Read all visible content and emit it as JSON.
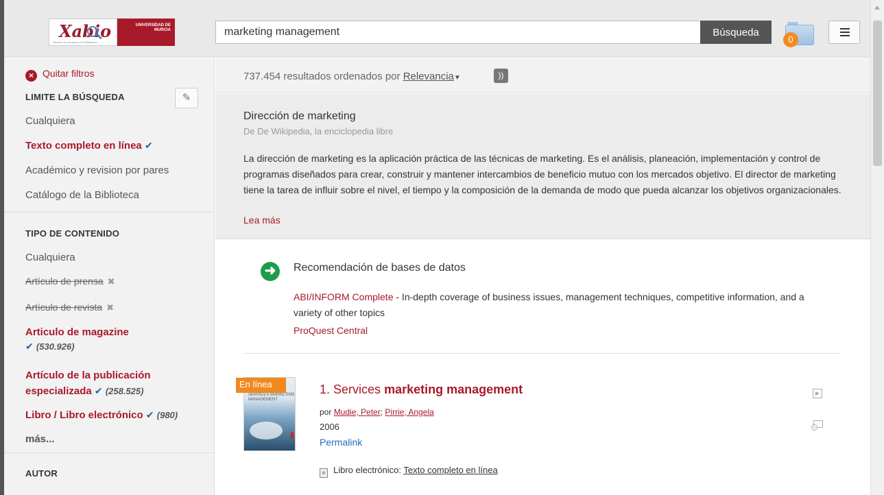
{
  "header": {
    "logo_name": "Xabio",
    "logo_sub": "Servicio de recursos de la Biblioteca",
    "university": "UNIVERSIDAD DE",
    "university_city": "MURCIA",
    "search_value": "marketing management",
    "search_button": "Búsqueda",
    "folder_count": "0",
    "brand_color": "#a8192a"
  },
  "sidebar": {
    "clear_filters": "Quitar filtros",
    "limit_heading": "LIMITE LA BÚSQUEDA",
    "limit_items": [
      {
        "label": "Cualquiera"
      },
      {
        "label": "Texto completo en línea"
      },
      {
        "label": "Académico y revision por pares"
      },
      {
        "label": "Catálogo de la Biblioteca"
      }
    ],
    "content_heading": "TIPO DE CONTENIDO",
    "content_items": [
      {
        "label": "Cualquiera"
      },
      {
        "label": "Artículo de prensa"
      },
      {
        "label": "Artículo de revista"
      },
      {
        "label": "Articulo de magazine",
        "count": "(530.926)"
      },
      {
        "label_line1": "Artículo de la publicación",
        "label_line2": "especializada",
        "count": "(258.525)"
      },
      {
        "label": "Libro / Libro electrónico",
        "count": "(980)"
      },
      {
        "label": "más..."
      }
    ],
    "author_heading": "AUTOR"
  },
  "results": {
    "count_text": "737.454 resultados ordenados por",
    "sort_label": "Relevancia",
    "wiki": {
      "title": "Dirección de marketing",
      "source": "De De Wikipedia, la enciclopedia libre",
      "desc": "La dirección de marketing es la aplicación práctica de las técnicas de marketing. Es el análisis, planeación, implementación y control de programas diseñados para crear, construir y mantener intercambios de beneficio mutuo con los mercados objetivo. El director de marketing tiene la tarea de influir sobre el nivel, el tiempo y la composición de la demanda de modo que pueda alcanzar los objetivos organizacionales.",
      "more": "Lea más"
    },
    "recommendation": {
      "title": "Recomendación de bases de datos",
      "db1_name": "ABI/INFORM Complete",
      "db1_desc": " - In-depth coverage of business issues, management techniques, competitive information, and a variety of other topics",
      "db2_name": "ProQuest Central"
    },
    "item1": {
      "online_tag": "En línea",
      "cover_title": "SERVICES MARKETING MANAGEMENT",
      "number": "1.",
      "title_plain": "Services",
      "title_bold": "marketing management",
      "by": "por",
      "author1": "Mudie, Peter",
      "author2": "Pirrie, Angela",
      "year": "2006",
      "permalink": "Permalink",
      "type_label": "Libro electrónico:",
      "type_link": "Texto completo en línea"
    }
  }
}
